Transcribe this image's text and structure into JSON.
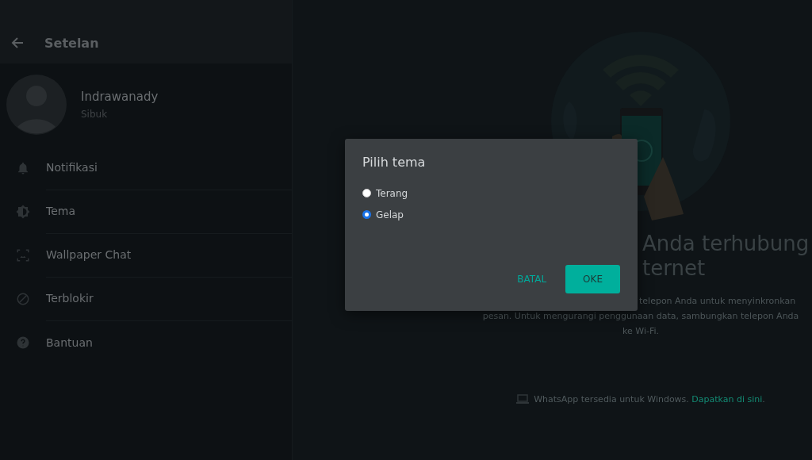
{
  "sidebar": {
    "title": "Setelan",
    "profile": {
      "name": "Indrawanady",
      "status": "Sibuk"
    },
    "items": [
      {
        "kind": "bell",
        "label": "Notifikasi"
      },
      {
        "kind": "theme",
        "label": "Tema"
      },
      {
        "kind": "wallpaper",
        "label": "Wallpaper Chat"
      },
      {
        "kind": "blocked",
        "label": "Terblokir"
      },
      {
        "kind": "help",
        "label": "Bantuan"
      }
    ]
  },
  "main": {
    "title_lines": [
      "Anda terhubung",
      "ternet"
    ],
    "description_lines": [
      "telepon Anda untuk menyinkronkan",
      "pesan. Untuk mengurangi penggunaan data, sambungkan telepon Anda",
      "ke Wi-Fi."
    ],
    "footer": {
      "text": "WhatsApp tersedia untuk Windows.",
      "link": "Dapatkan di sini",
      "end": "."
    }
  },
  "dialog": {
    "title": "Pilih tema",
    "options": [
      {
        "label": "Terang",
        "selected": false
      },
      {
        "label": "Gelap",
        "selected": true
      }
    ],
    "buttons": [
      {
        "kind": "text",
        "label": "BATAL"
      },
      {
        "kind": "filled",
        "label": "OKE"
      }
    ]
  }
}
